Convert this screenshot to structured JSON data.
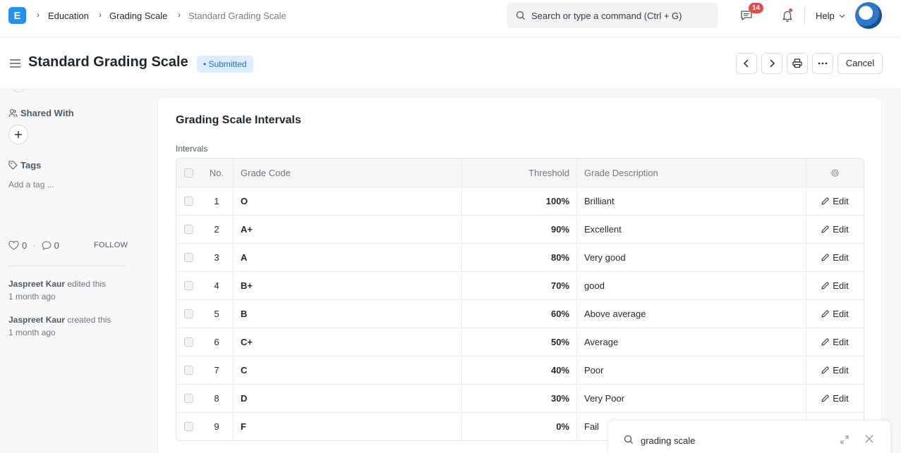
{
  "navbar": {
    "logo_letter": "E",
    "breadcrumbs": [
      "Education",
      "Grading Scale",
      "Standard Grading Scale"
    ],
    "search_placeholder": "Search or type a command (Ctrl + G)",
    "notification_count": "14",
    "help_label": "Help"
  },
  "page": {
    "title": "Standard Grading Scale",
    "status": "• Submitted",
    "cancel_label": "Cancel"
  },
  "sidebar": {
    "shared_with": "Shared With",
    "tags": "Tags",
    "add_tag": "Add a tag ...",
    "likes": "0",
    "comments": "0",
    "follow": "FOLLOW",
    "activity": [
      {
        "user": "Jaspreet Kaur",
        "action": " edited this",
        "time": "1 month ago"
      },
      {
        "user": "Jaspreet Kaur",
        "action": " created this",
        "time": "1 month ago"
      }
    ]
  },
  "section": {
    "title": "Grading Scale Intervals",
    "field_label": "Intervals",
    "columns": {
      "no": "No.",
      "code": "Grade Code",
      "threshold": "Threshold",
      "description": "Grade Description"
    },
    "edit_label": "Edit",
    "rows": [
      {
        "no": "1",
        "code": "O",
        "threshold": "100%",
        "description": "Brilliant"
      },
      {
        "no": "2",
        "code": "A+",
        "threshold": "90%",
        "description": "Excellent"
      },
      {
        "no": "3",
        "code": "A",
        "threshold": "80%",
        "description": "Very good"
      },
      {
        "no": "4",
        "code": "B+",
        "threshold": "70%",
        "description": "good"
      },
      {
        "no": "5",
        "code": "B",
        "threshold": "60%",
        "description": "Above average"
      },
      {
        "no": "6",
        "code": "C+",
        "threshold": "50%",
        "description": "Average"
      },
      {
        "no": "7",
        "code": "C",
        "threshold": "40%",
        "description": "Poor"
      },
      {
        "no": "8",
        "code": "D",
        "threshold": "30%",
        "description": "Very Poor"
      },
      {
        "no": "9",
        "code": "F",
        "threshold": "0%",
        "description": "Fail"
      }
    ]
  },
  "float_search": {
    "query": "grading scale"
  },
  "colors": {
    "accent": "#2490ef",
    "status_bg": "#dcedfb",
    "status_text": "#2070bd",
    "badge": "#e24c4c"
  }
}
